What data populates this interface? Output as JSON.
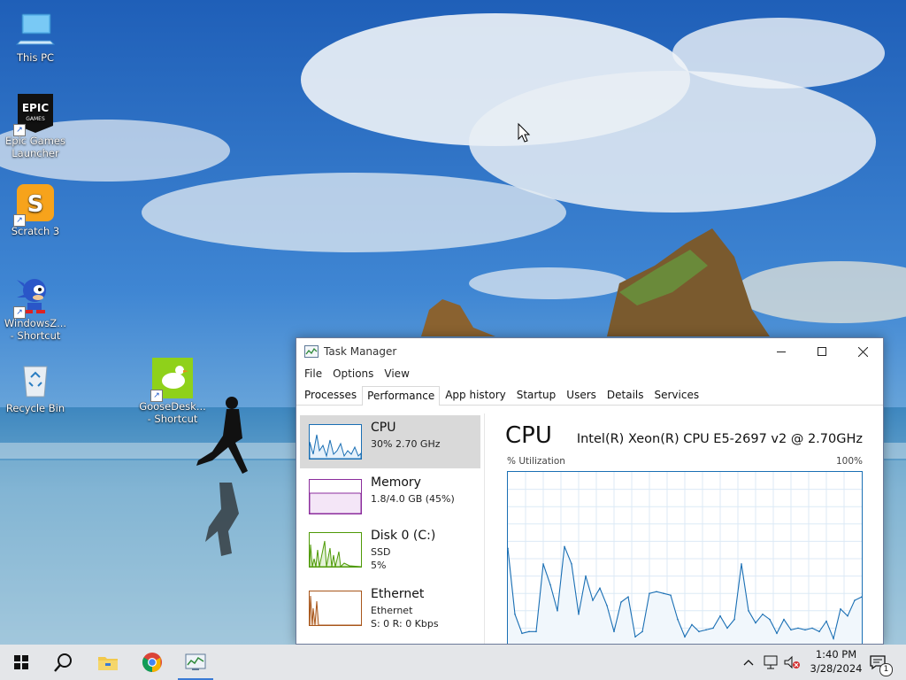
{
  "desktop": {
    "icons": [
      {
        "label_1": "This PC",
        "label_2": ""
      },
      {
        "label_1": "Epic Games",
        "label_2": "Launcher",
        "art": "EPIC GAMES"
      },
      {
        "label_1": "Scratch 3",
        "label_2": ""
      },
      {
        "label_1": "WindowsZ...",
        "label_2": "- Shortcut"
      },
      {
        "label_1": "Recycle Bin",
        "label_2": ""
      },
      {
        "label_1": "GooseDesk...",
        "label_2": "- Shortcut"
      }
    ]
  },
  "task_manager": {
    "title": "Task Manager",
    "menu": [
      "File",
      "Options",
      "View"
    ],
    "tabs": [
      "Processes",
      "Performance",
      "App history",
      "Startup",
      "Users",
      "Details",
      "Services"
    ],
    "active_tab": "Performance",
    "resources": [
      {
        "name": "CPU",
        "line1": "30%  2.70 GHz",
        "line2": "",
        "color": "#1a6fb4"
      },
      {
        "name": "Memory",
        "line1": "1.8/4.0 GB (45%)",
        "line2": "",
        "color": "#8b2c9c"
      },
      {
        "name": "Disk 0 (C:)",
        "line1": "SSD",
        "line2": "5%",
        "color": "#4e9a06"
      },
      {
        "name": "Ethernet",
        "line1": "Ethernet",
        "line2": "S: 0  R: 0 Kbps",
        "color": "#a8561b"
      }
    ],
    "detail": {
      "title": "CPU",
      "model": "Intel(R) Xeon(R) CPU E5-2697 v2 @ 2.70GHz",
      "y_label": "% Utilization",
      "y_max_label": "100%"
    }
  },
  "chart_data": {
    "type": "area",
    "ylabel": "% Utilization",
    "ylim": [
      0,
      100
    ],
    "color": "#1a6fb4",
    "values": [
      56,
      18,
      7,
      8,
      8,
      47,
      35,
      20,
      57,
      47,
      18,
      40,
      26,
      33,
      23,
      8,
      25,
      28,
      5,
      8,
      30,
      31,
      30,
      29,
      15,
      5,
      12,
      8,
      9,
      10,
      17,
      10,
      15,
      47,
      20,
      13,
      18,
      15,
      7,
      15,
      9,
      10,
      9,
      10,
      8,
      14,
      4,
      21,
      17,
      26,
      28
    ]
  },
  "taskbar": {
    "time": "1:40 PM",
    "date": "3/28/2024",
    "notification_count": "1",
    "icons": [
      "windows-start-icon",
      "search-icon",
      "file-explorer-icon",
      "chrome-icon",
      "task-manager-icon"
    ]
  }
}
